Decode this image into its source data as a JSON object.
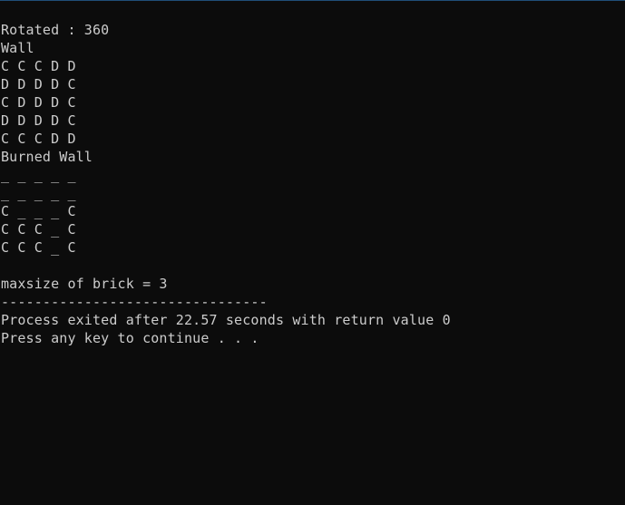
{
  "console": {
    "lines": [
      "Rotated : 360",
      "Wall",
      "C C C D D",
      "D D D D C",
      "C D D D C",
      "D D D D C",
      "C C C D D",
      "Burned Wall",
      "_ _ _ _ _",
      "_ _ _ _ _",
      "C _ _ _ C",
      "C C C _ C",
      "C C C _ C",
      "",
      "maxsize of brick = 3",
      "--------------------------------",
      "Process exited after 22.57 seconds with return value 0",
      "Press any key to continue . . ."
    ]
  }
}
